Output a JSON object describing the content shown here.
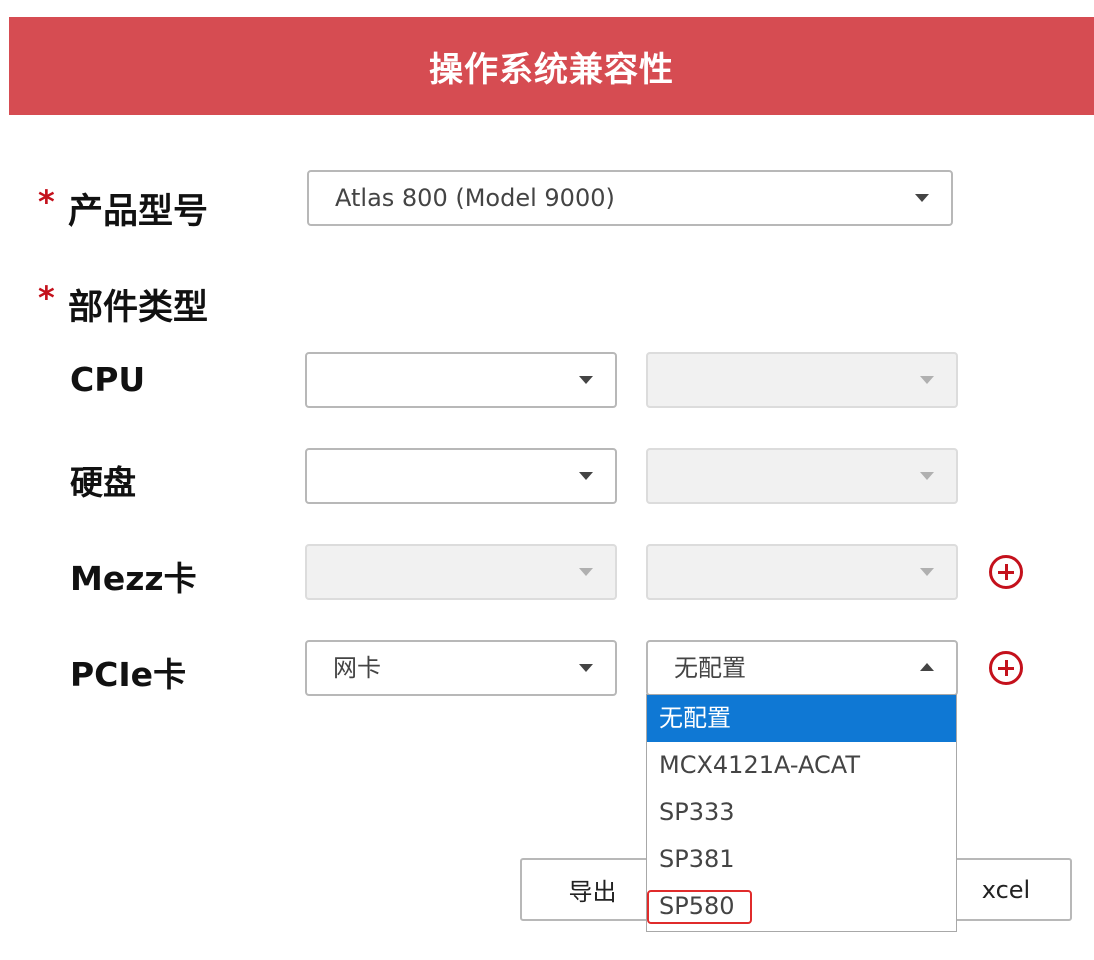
{
  "header": {
    "title": "操作系统兼容性"
  },
  "form": {
    "required_mark": "*",
    "product_model": {
      "label": "产品型号",
      "value": "Atlas 800 (Model 9000)"
    },
    "component_type": {
      "label": "部件类型"
    },
    "rows": {
      "cpu": {
        "label": "CPU",
        "value1": "",
        "value2": ""
      },
      "disk": {
        "label": "硬盘",
        "value1": "",
        "value2": ""
      },
      "mezz": {
        "label": "Mezz卡",
        "value1": "",
        "value2": ""
      },
      "pcie": {
        "label": "PCIe卡",
        "value1": "网卡",
        "value2": "无配置"
      }
    },
    "pcie_dropdown": {
      "options": [
        "无配置",
        "MCX4121A-ACAT",
        "SP333",
        "SP381",
        "SP580"
      ],
      "selected_index": 0,
      "highlighted_option": "SP580"
    }
  },
  "actions": {
    "export_label": "导出",
    "excel_label": "xcel"
  },
  "colors": {
    "banner": "#d64c52",
    "required": "#c4111c",
    "selected_option": "#0f78d4",
    "highlight_box": "#e02b2b"
  },
  "icons": {
    "dropdown_caret": "caret-down-icon",
    "add": "plus-circle-icon"
  }
}
